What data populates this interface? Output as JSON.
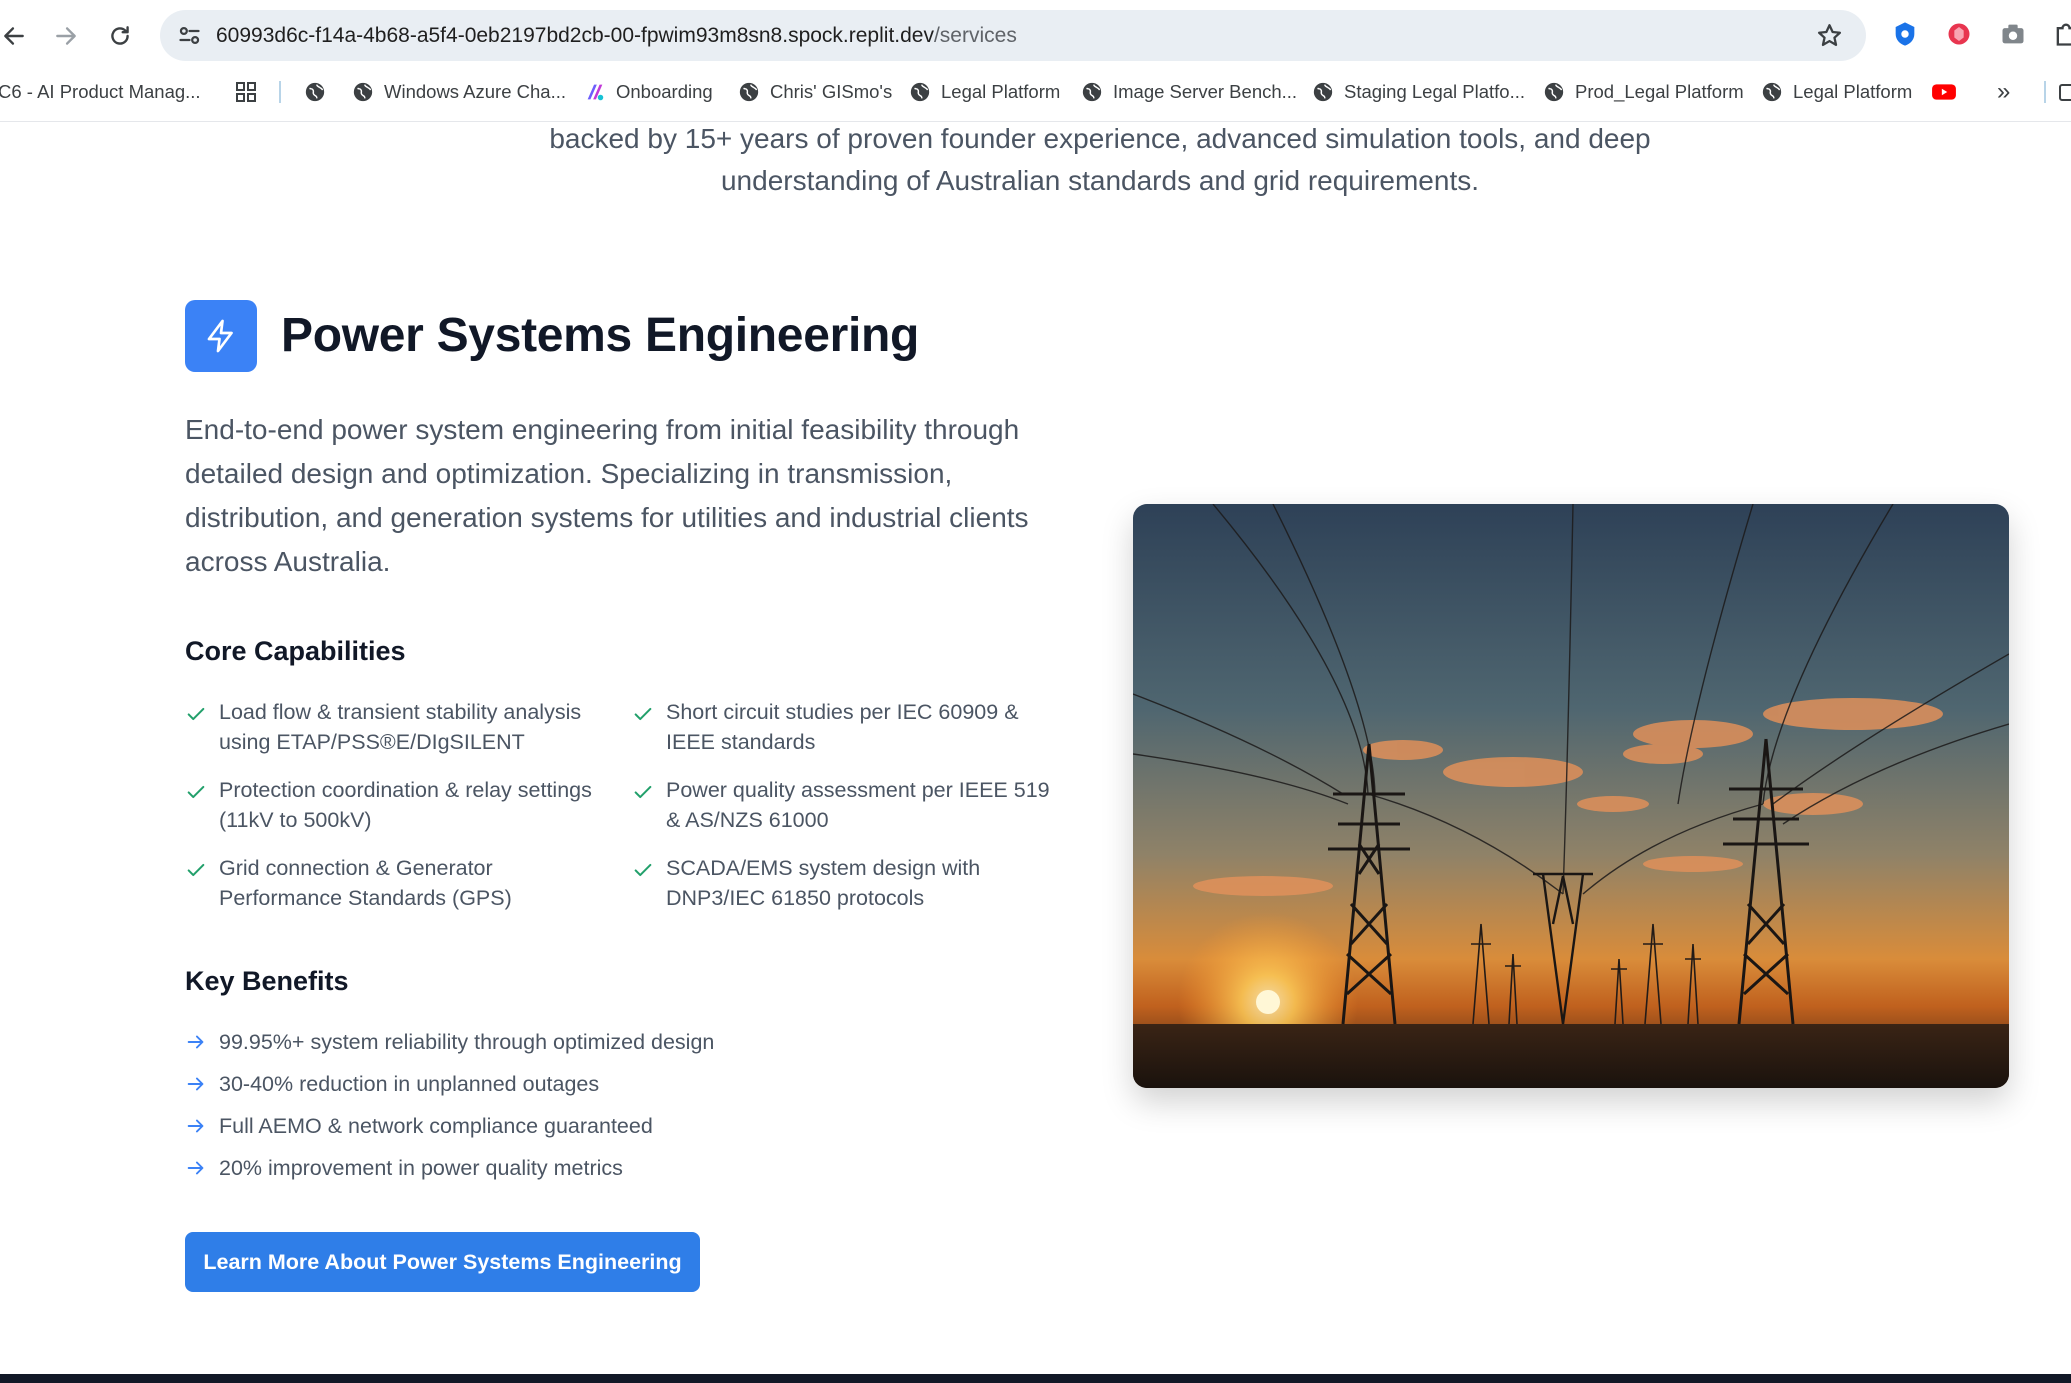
{
  "browser": {
    "url_host": "60993d6c-f14a-4b68-a5f4-0eb2197bd2cb-00-fpwim93m8sn8.spock.replit.dev",
    "url_path": "/services",
    "bookmarks": [
      {
        "label": "C6 - AI Product Manag...",
        "icon": "none"
      },
      {
        "label": "",
        "icon": "apps-grid-icon"
      },
      {
        "label": "",
        "icon": "globe-icon"
      },
      {
        "label": "Windows Azure Cha...",
        "icon": "globe-icon"
      },
      {
        "label": "Onboarding",
        "icon": "onboarding-logo-icon"
      },
      {
        "label": "Chris' GISmo's",
        "icon": "globe-icon"
      },
      {
        "label": "Legal Platform",
        "icon": "globe-icon"
      },
      {
        "label": "Image Server Bench...",
        "icon": "globe-icon"
      },
      {
        "label": "Staging Legal Platfo...",
        "icon": "globe-icon"
      },
      {
        "label": "Prod_Legal Platform",
        "icon": "globe-icon"
      },
      {
        "label": "Legal Platform",
        "icon": "globe-icon"
      },
      {
        "label": "",
        "icon": "youtube-icon"
      },
      {
        "label": "»",
        "icon": "overflow-chevron-icon"
      }
    ]
  },
  "page": {
    "intro_line1": "backed by 15+ years of proven founder experience, advanced simulation tools, and deep",
    "intro_line2": "understanding of Australian standards and grid requirements.",
    "service": {
      "icon": "lightning-bolt-icon",
      "title": "Power Systems Engineering",
      "description": "End-to-end power system engineering from initial feasibility through detailed design and optimization. Specializing in transmission, distribution, and generation systems for utilities and industrial clients across Australia.",
      "capabilities_heading": "Core Capabilities",
      "capabilities": [
        "Load flow & transient stability analysis using ETAP/PSS®E/DIgSILENT",
        "Short circuit studies per IEC 60909 & IEEE standards",
        "Protection coordination & relay settings (11kV to 500kV)",
        "Power quality assessment per IEEE 519 & AS/NZS 61000",
        "Grid connection & Generator Performance Standards (GPS)",
        "SCADA/EMS system design with DNP3/IEC 61850 protocols"
      ],
      "benefits_heading": "Key Benefits",
      "benefits": [
        "99.95%+ system reliability through optimized design",
        "30-40% reduction in unplanned outages",
        "Full AEMO & network compliance guaranteed",
        "20% improvement in power quality metrics"
      ],
      "cta_label": "Learn More About Power Systems Engineering"
    }
  },
  "colors": {
    "accent": "#3b82f6",
    "check": "#22a06b",
    "arrow": "#3b82f6",
    "button": "#2f7ee8"
  }
}
